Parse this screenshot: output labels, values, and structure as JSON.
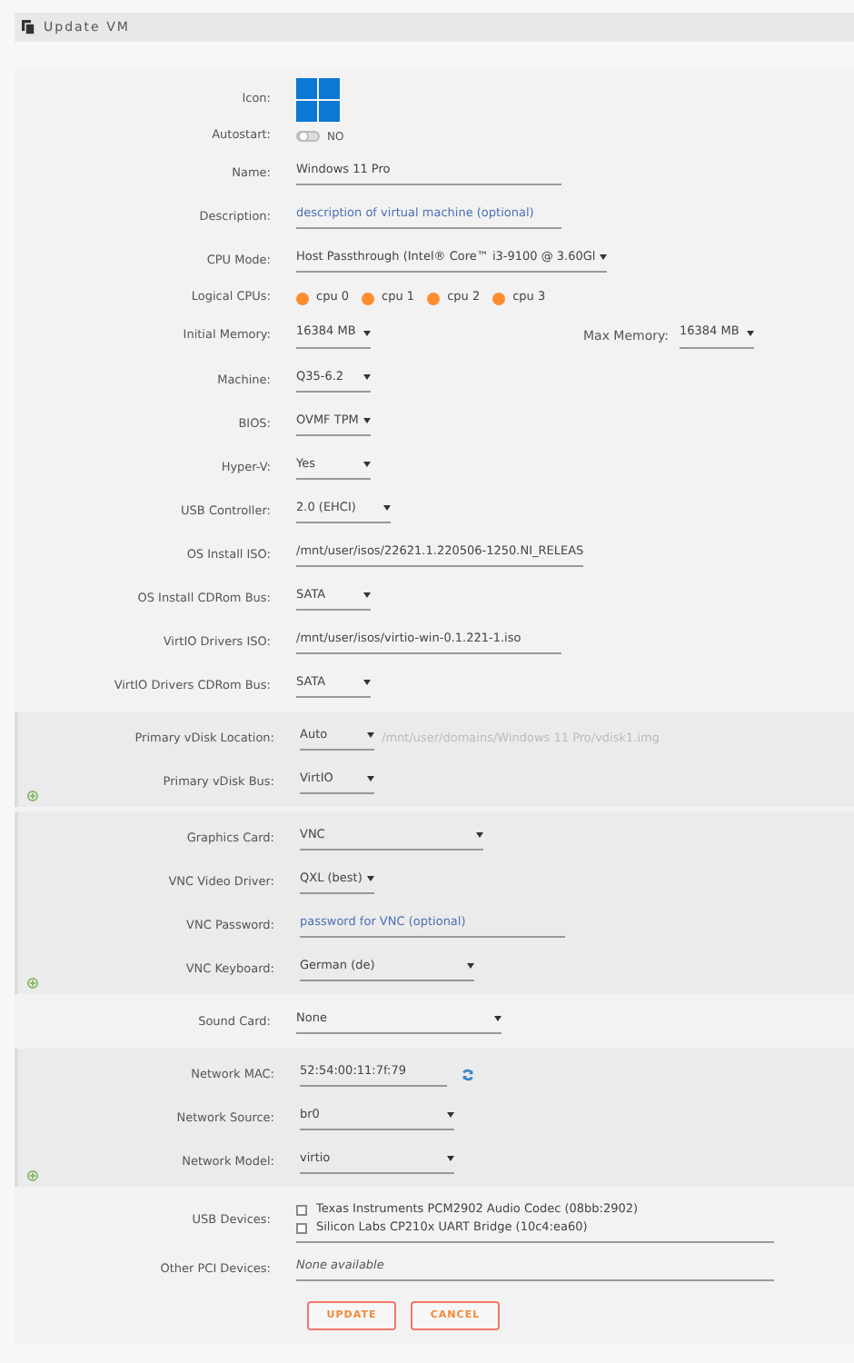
{
  "header": {
    "title": "Update VM"
  },
  "sections": [
    {
      "shaded": false,
      "add_button": false,
      "rows": [
        {
          "label": "Icon:",
          "kind": "icon"
        },
        {
          "label": "Autostart:",
          "kind": "toggle",
          "on": false,
          "text": "NO"
        },
        {
          "label": "Name:",
          "kind": "input",
          "value": "Windows 11 Pro"
        },
        {
          "label": "Description:",
          "kind": "input",
          "placeholder": "description of virtual machine (optional)"
        },
        {
          "label": "CPU Mode:",
          "kind": "select",
          "value": "Host Passthrough (Intel® Core™ i3-9100 @ 3.60Gl"
        },
        {
          "label": "Logical CPUs:",
          "kind": "cpus",
          "cpus": [
            {
              "label": "cpu 0",
              "selected": true
            },
            {
              "label": "cpu 1",
              "selected": true
            },
            {
              "label": "cpu 2",
              "selected": true
            },
            {
              "label": "cpu 3",
              "selected": true
            }
          ]
        },
        {
          "label": "Initial Memory:",
          "kind": "memory",
          "value": "16384 MB",
          "max_label": "Max Memory:",
          "max_value": "16384 MB"
        },
        {
          "label": "Machine:",
          "kind": "select",
          "value": "Q35-6.2"
        },
        {
          "label": "BIOS:",
          "kind": "select",
          "value": "OVMF TPM"
        },
        {
          "label": "Hyper-V:",
          "kind": "select",
          "value": "Yes"
        },
        {
          "label": "USB Controller:",
          "kind": "select",
          "value": "2.0 (EHCI)"
        },
        {
          "label": "OS Install ISO:",
          "kind": "input",
          "value": "/mnt/user/isos/22621.1.220506-1250.NI_RELEAS"
        },
        {
          "label": "OS Install CDRom Bus:",
          "kind": "select",
          "value": "SATA"
        },
        {
          "label": "VirtIO Drivers ISO:",
          "kind": "input",
          "value": "/mnt/user/isos/virtio-win-0.1.221-1.iso"
        },
        {
          "label": "VirtIO Drivers CDRom Bus:",
          "kind": "select",
          "value": "SATA"
        }
      ]
    },
    {
      "shaded": true,
      "add_button": true,
      "rows": [
        {
          "label": "Primary vDisk Location:",
          "kind": "select",
          "value": "Auto",
          "hint": "/mnt/user/domains/Windows 11 Pro/vdisk1.img"
        },
        {
          "label": "Primary vDisk Bus:",
          "kind": "select",
          "value": "VirtIO"
        }
      ]
    },
    {
      "shaded": true,
      "add_button": true,
      "rows": [
        {
          "label": "Graphics Card:",
          "kind": "select",
          "value": "VNC"
        },
        {
          "label": "VNC Video Driver:",
          "kind": "select",
          "value": "QXL (best)"
        },
        {
          "label": "VNC Password:",
          "kind": "input",
          "placeholder": "password for VNC (optional)"
        },
        {
          "label": "VNC Keyboard:",
          "kind": "select",
          "value": "German (de)"
        }
      ]
    },
    {
      "shaded": false,
      "add_button": false,
      "rows": [
        {
          "label": "Sound Card:",
          "kind": "select",
          "value": "None"
        }
      ]
    },
    {
      "shaded": true,
      "add_button": true,
      "rows": [
        {
          "label": "Network MAC:",
          "kind": "mac",
          "value": "52:54:00:11:7f:79"
        },
        {
          "label": "Network Source:",
          "kind": "select",
          "value": "br0"
        },
        {
          "label": "Network Model:",
          "kind": "select",
          "value": "virtio"
        }
      ]
    },
    {
      "shaded": false,
      "add_button": false,
      "rows": [
        {
          "label": "USB Devices:",
          "kind": "checklist",
          "items": [
            {
              "label": "Texas Instruments PCM2902 Audio Codec (08bb:2902)",
              "checked": false
            },
            {
              "label": "Silicon Labs CP210x UART Bridge (10c4:ea60)",
              "checked": false
            }
          ]
        },
        {
          "label": "Other PCI Devices:",
          "kind": "note",
          "text": "None available"
        }
      ]
    }
  ],
  "buttons": [
    "UPDATE",
    "CANCEL"
  ]
}
